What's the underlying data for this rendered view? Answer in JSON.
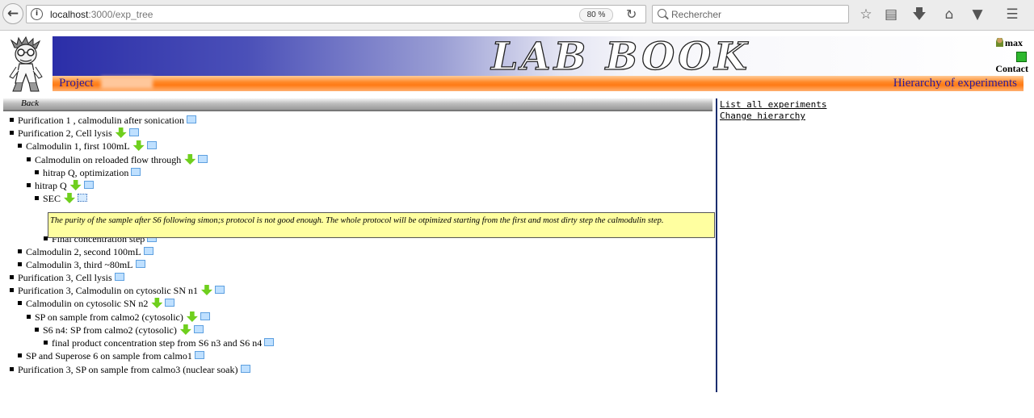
{
  "browser": {
    "url_host": "localhost",
    "url_path": ":3000/exp_tree",
    "zoom": "80 %",
    "search_placeholder": "Rechercher"
  },
  "header": {
    "banner_title": "LAB BOOK",
    "project_label": "Project",
    "hierarchy_label": "Hierarchy of experiments",
    "user_name": "max",
    "contact_label": "Contact",
    "back_label": "Back"
  },
  "sidebar": {
    "links": [
      "List all experiments",
      "Change hierarchy"
    ]
  },
  "tree": [
    {
      "level": 0,
      "label": "Purification 1 , calmodulin after sonication",
      "arrow": false
    },
    {
      "level": 0,
      "label": "Purification 2, Cell lysis",
      "arrow": true
    },
    {
      "level": 1,
      "label": "Calmodulin 1, first 100mL",
      "arrow": true
    },
    {
      "level": 2,
      "label": "Calmodulin on reloaded flow through",
      "arrow": true
    },
    {
      "level": 3,
      "label": "hitrap Q, optimization",
      "arrow": false
    },
    {
      "level": 2,
      "label": "hitrap Q",
      "arrow": true
    },
    {
      "level": 3,
      "label": "SEC",
      "arrow": true
    },
    {
      "level": 4,
      "label": "Final concentration step",
      "arrow": false
    },
    {
      "level": 1,
      "label": "Calmodulin 2, second 100mL",
      "arrow": false
    },
    {
      "level": 1,
      "label": "Calmodulin 3, third ~80mL",
      "arrow": false
    },
    {
      "level": 0,
      "label": "Purification 3, Cell lysis",
      "arrow": false
    },
    {
      "level": 0,
      "label": "Purification 3, Calmodulin on cytosolic SN n1",
      "arrow": true
    },
    {
      "level": 1,
      "label": "Calmodulin on cytosolic SN n2",
      "arrow": true
    },
    {
      "level": 2,
      "label": "SP on sample from calmo2 (cytosolic)",
      "arrow": true
    },
    {
      "level": 3,
      "label": "S6 n4: SP from calmo2 (cytosolic)",
      "arrow": true
    },
    {
      "level": 4,
      "label": "final product concentration step from S6 n3 and S6 n4",
      "arrow": false
    },
    {
      "level": 1,
      "label": "SP and Superose 6 on sample from calmo1",
      "arrow": false
    },
    {
      "level": 0,
      "label": "Purification 3, SP on sample from calmo3 (nuclear soak)",
      "arrow": false
    }
  ],
  "note": "The purity of the sample after S6 following simon;s protocol is not good enough. The whole protocol will be otpimized starting from the first and most dirty step the calmodulin step."
}
